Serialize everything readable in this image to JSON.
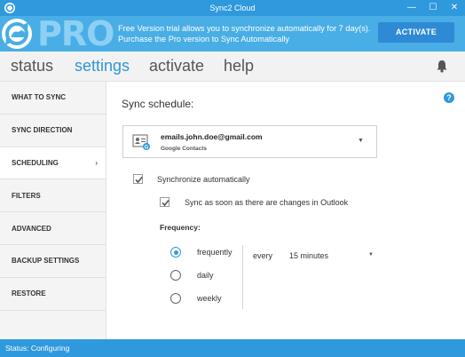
{
  "window": {
    "title": "Sync2 Cloud",
    "minimize_glyph": "—",
    "maximize_glyph": "☐",
    "close_glyph": "✕"
  },
  "banner": {
    "pro_text": "PRO",
    "message_line1": "Free Version trial allows you to synchronize automatically for 7 day(s).",
    "message_line2": "Purchase the Pro version to Sync Automatically",
    "activate_label": "ACTIVATE"
  },
  "topnav": {
    "tabs": [
      {
        "label": "status",
        "active": false
      },
      {
        "label": "settings",
        "active": true
      },
      {
        "label": "activate",
        "active": false
      },
      {
        "label": "help",
        "active": false
      }
    ],
    "bell_icon": "bell-icon"
  },
  "sidebar": {
    "items": [
      {
        "label": "WHAT TO SYNC"
      },
      {
        "label": "SYNC DIRECTION"
      },
      {
        "label": "SCHEDULING",
        "active": true
      },
      {
        "label": "FILTERS"
      },
      {
        "label": "ADVANCED"
      },
      {
        "label": "BACKUP SETTINGS"
      },
      {
        "label": "RESTORE"
      }
    ],
    "chevron": "›"
  },
  "main": {
    "help_glyph": "?",
    "title": "Sync schedule:",
    "account": {
      "email": "emails.john.doe@gmail.com",
      "provider": "Google Contacts",
      "dropdown_glyph": "▼"
    },
    "sync_auto": {
      "label": "Synchronize automatically",
      "checked": true
    },
    "sync_on_change": {
      "label": "Sync as soon as there are changes in Outlook",
      "checked": true
    },
    "frequency": {
      "label": "Frequency:",
      "options": [
        {
          "label": "frequently",
          "selected": true
        },
        {
          "label": "daily",
          "selected": false
        },
        {
          "label": "weekly",
          "selected": false
        }
      ],
      "every_label": "every",
      "interval_value": "15 minutes",
      "dropdown_glyph": "▼"
    }
  },
  "status_bar": {
    "text": "Status: Configuring"
  },
  "colors": {
    "accent": "#2f99dd",
    "banner": "#48aee5",
    "active_tab": "#2e96d8"
  }
}
